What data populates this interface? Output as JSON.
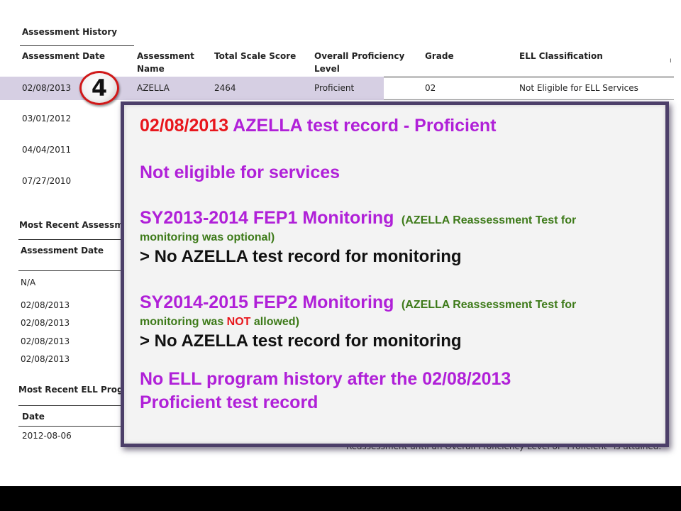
{
  "history": {
    "section_title": "Assessment History",
    "columns": [
      "Assessment Date",
      "Assessment\nName",
      "Total Scale Score",
      "Overall Proficiency\nLevel",
      "Grade",
      "ELL Classification"
    ],
    "highlight_row": {
      "date": "02/08/2013",
      "name": "AZELLA",
      "score": "2464",
      "level": "Proficient",
      "grade": "02",
      "classification": "Not Eligible for ELL Services"
    },
    "other_dates": [
      "03/01/2012",
      "04/04/2011",
      "07/27/2010"
    ],
    "badge_number": "4"
  },
  "recent_assessment": {
    "section_title": "Most Recent Assessmen",
    "column": "Assessment Date",
    "values": [
      "N/A",
      "02/08/2013",
      "02/08/2013",
      "02/08/2013",
      "02/08/2013"
    ]
  },
  "recent_program": {
    "section_title": "Most Recent ELL Progra",
    "column": "Date",
    "value": "2012-08-06"
  },
  "clipped_footer_text": "Reassessment until an Overall Proficiency Level of \"Proficient\" is attained.",
  "overlay": {
    "line1_date": "02/08/2013",
    "line1_rest": " AZELLA test record - Proficient",
    "line2": "Not eligible for services",
    "fep1_title": "SY2013-2014 FEP1 Monitoring",
    "fep1_note_a": "(AZELLA Reassessment Test for",
    "fep1_note_b": "monitoring was optional)",
    "fep1_result": "> No AZELLA test record for monitoring",
    "fep2_title": "SY2014-2015 FEP2 Monitoring",
    "fep2_note_a": "(AZELLA Reassessment Test for",
    "fep2_note_b1": "monitoring was ",
    "fep2_note_not": "NOT",
    "fep2_note_b2": " allowed)",
    "fep2_result": "> No AZELLA test record for monitoring",
    "final_line1": "No ELL program history after the 02/08/2013",
    "final_line2": "Proficient test record"
  },
  "colors": {
    "highlight_row": "#d6cfe3",
    "overlay_border": "#4c3f69",
    "red": "#e8161c",
    "purple": "#b020d8",
    "green": "#3d7a19"
  }
}
